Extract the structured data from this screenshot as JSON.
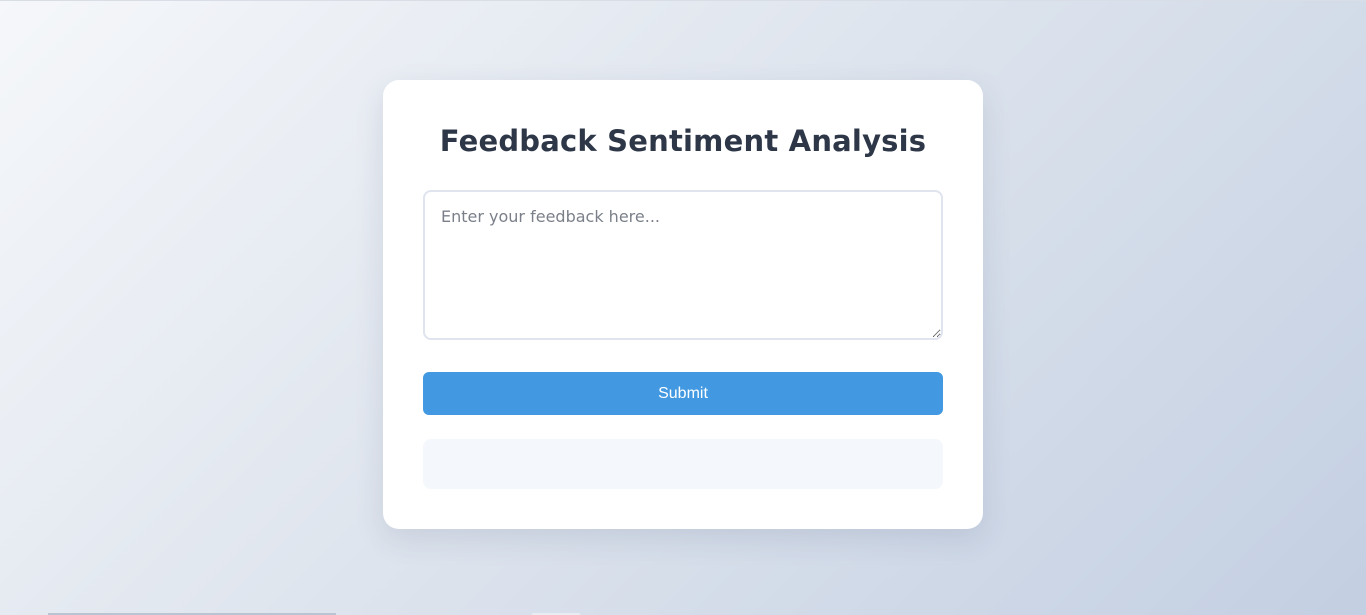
{
  "page": {
    "title": "Feedback Sentiment Analysis"
  },
  "form": {
    "feedback_placeholder": "Enter your feedback here...",
    "feedback_value": "",
    "submit_label": "Submit"
  },
  "result": {
    "text": ""
  },
  "colors": {
    "accent": "#4299e1",
    "title": "#2d3748",
    "card": "#ffffff",
    "result_bg": "#f4f7fb"
  }
}
